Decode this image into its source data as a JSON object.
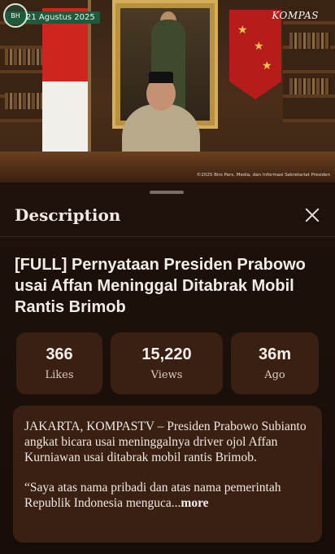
{
  "video": {
    "date_overlay": "21 Agustus 2025",
    "logo_label": "BH",
    "channel_watermark": "KOMPAS",
    "credit": "©2025 Biro Pers, Media, dan Informasi Sekretariat Presiden"
  },
  "sheet": {
    "title": "Description",
    "close_label": "close"
  },
  "video_title": "[FULL] Pernyataan Presiden Prabowo usai Affan Meninggal Ditabrak Mobil Rantis Brimob",
  "stats": [
    {
      "value": "366",
      "label": "Likes"
    },
    {
      "value": "15,220",
      "label": "Views"
    },
    {
      "value": "36m",
      "label": "Ago"
    }
  ],
  "description": {
    "para1": "JAKARTA, KOMPASTV – Presiden Prabowo Subianto angkat bicara usai meninggalnya driver ojol Affan Kurniawan usai ditabrak mobil rantis Brimob.",
    "para2": "“Saya atas nama pribadi dan atas nama pemerintah Republik Indonesia menguca...",
    "more_label": "more"
  },
  "colors": {
    "background": "#1a0f0a",
    "card": "#3a1f13",
    "text": "#f3ece6"
  }
}
